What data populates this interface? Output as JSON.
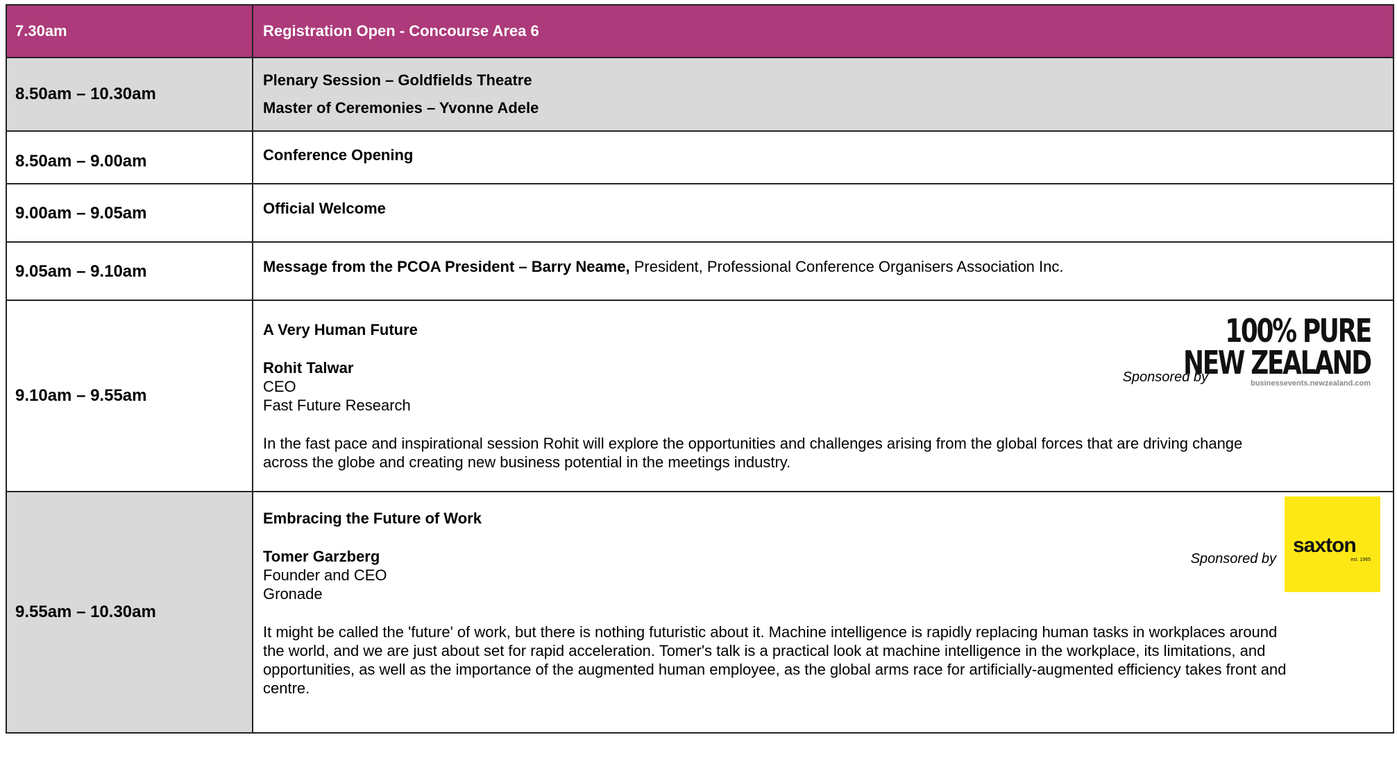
{
  "rows": [
    {
      "time": "7.30am",
      "desc": "Registration Open -  Concourse Area 6"
    },
    {
      "time": "8.50am – 10.30am",
      "line1": "Plenary Session – Goldfields Theatre",
      "line2": "Master of Ceremonies – Yvonne Adele"
    },
    {
      "time": "8.50am – 9.00am",
      "desc": "Conference Opening"
    },
    {
      "time": "9.00am – 9.05am",
      "desc": "Official Welcome"
    },
    {
      "time": "9.05am – 9.10am",
      "desc_bold": "Message from the PCOA President – Barry Neame,",
      "desc_rest": " President, Professional Conference Organisers Association Inc."
    },
    {
      "time": "9.10am – 9.55am",
      "title": "A Very Human Future",
      "speaker": "Rohit Talwar",
      "role": "CEO",
      "org": "Fast Future Research",
      "abstract_l1": "In the fast pace and inspirational session Rohit will explore the opportunities and challenges arising from the global forces that are driving change",
      "abstract_l2": "across the globe and creating new business potential in the meetings industry.",
      "sponsor_label": "Sponsored by",
      "logo_line1": "100% PURE",
      "logo_line2": "NEW ZEALAND",
      "logo_url": "businessevents.newzealand.com"
    },
    {
      "time": "9.55am – 10.30am",
      "title": "Embracing the Future of Work",
      "speaker": "Tomer Garzberg",
      "role": "Founder and CEO",
      "org": "Gronade",
      "abstract_l1": "It might be called the 'future' of work, but there is nothing futuristic about it. Machine intelligence is rapidly replacing human tasks in workplaces around",
      "abstract_l2": "the world, and we are just about set for rapid acceleration. Tomer's talk is a practical look at machine intelligence in the workplace, its limitations, and",
      "abstract_l3": "opportunities, as well as the importance of the augmented human employee, as the global arms race for artificially-augmented efficiency takes front and",
      "abstract_l4": "centre.",
      "sponsor_label": "Sponsored by",
      "logo_word": "saxton",
      "logo_est": "est. 1965"
    }
  ],
  "colors": {
    "header_bg": "#ad3a7a",
    "shade": "#d9d9d9",
    "saxton_yellow": "#fde816"
  }
}
